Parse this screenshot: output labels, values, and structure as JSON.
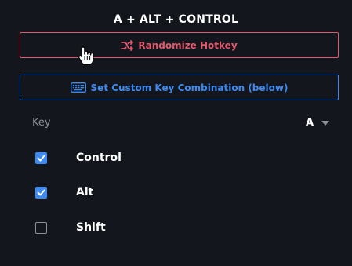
{
  "header": {
    "title": "A + ALT + CONTROL"
  },
  "buttons": {
    "randomize_label": "Randomize Hotkey",
    "custom_label": "Set Custom Key Combination (below)"
  },
  "key_selector": {
    "label": "Key",
    "value": "A"
  },
  "modifiers": [
    {
      "label": "Control",
      "checked": true
    },
    {
      "label": "Alt",
      "checked": true
    },
    {
      "label": "Shift",
      "checked": false
    }
  ],
  "colors": {
    "background": "#13161d",
    "randomize_accent": "#e05a6e",
    "custom_accent": "#3d8af0",
    "checkbox_on": "#3d8af0"
  },
  "icons": {
    "randomize": "shuffle-icon",
    "custom": "keyboard-icon",
    "select": "caret-down-icon",
    "checked": "checkmark-icon",
    "pointer": "hand-cursor-icon"
  }
}
